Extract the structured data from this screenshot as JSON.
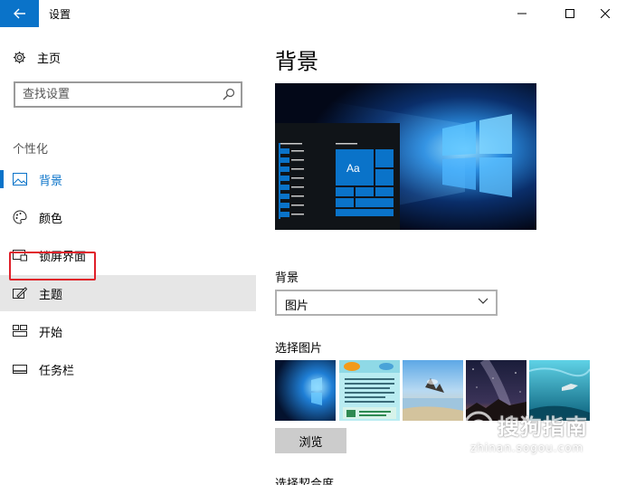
{
  "window": {
    "title": "设置"
  },
  "sidebar": {
    "home_label": "主页",
    "search_placeholder": "查找设置",
    "section_label": "个性化",
    "items": [
      {
        "label": "背景",
        "icon": "picture-icon",
        "selected": true
      },
      {
        "label": "颜色",
        "icon": "palette-icon"
      },
      {
        "label": "锁屏界面",
        "icon": "lock-screen-icon"
      },
      {
        "label": "主题",
        "icon": "theme-brush-icon",
        "hover": true,
        "highlighted": true
      },
      {
        "label": "开始",
        "icon": "start-tiles-icon"
      },
      {
        "label": "任务栏",
        "icon": "taskbar-icon"
      }
    ]
  },
  "main": {
    "title": "背景",
    "preview_tile_text": "Aa",
    "background_label": "背景",
    "background_value": "图片",
    "choose_label": "选择图片",
    "browse_label": "浏览",
    "next_label": "选择契合度"
  },
  "colors": {
    "accent": "#0a73c9",
    "highlight_box": "#e0202a",
    "hover_bg": "#e6e6e6"
  },
  "watermark": {
    "text": "搜狗指南",
    "url": "zhinan.sogou.com"
  }
}
